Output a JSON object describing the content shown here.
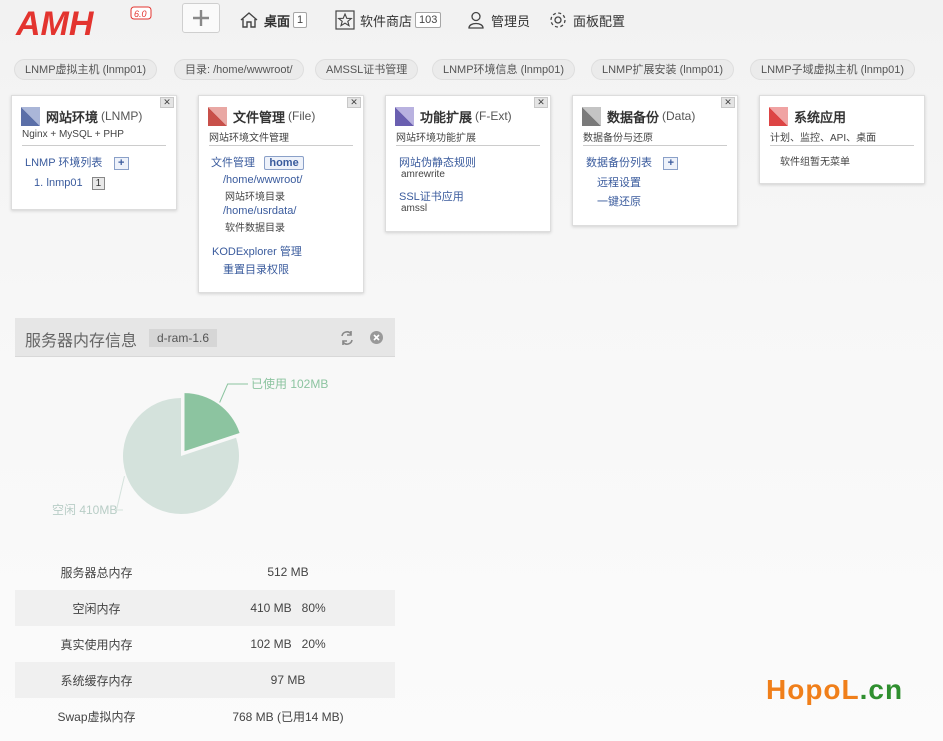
{
  "logo": {
    "text": "AMH",
    "version": "6.0"
  },
  "nav": {
    "desktop": {
      "label": "桌面",
      "count": "1"
    },
    "store": {
      "label": "软件商店",
      "count": "103"
    },
    "admin": {
      "label": "管理员"
    },
    "settings": {
      "label": "面板配置"
    }
  },
  "pills": [
    "LNMP虚拟主机 (lnmp01)",
    "目录: /home/wwwroot/",
    "AMSSL证书管理",
    "LNMP环境信息 (lnmp01)",
    "LNMP扩展安装 (lnmp01)",
    "LNMP子域虚拟主机 (lnmp01)"
  ],
  "cards": {
    "lnmp": {
      "title": "网站环境",
      "en": "(LNMP)",
      "sub": "Nginx + MySQL + PHP",
      "list_label": "LNMP 环境列表",
      "item_index": "1.",
      "item_name": "lnmp01",
      "item_count": "1",
      "color": "#5b6fa8"
    },
    "file": {
      "title": "文件管理",
      "en": "(File)",
      "sub": "网站环境文件管理",
      "link1": "文件管理",
      "home": "home",
      "path1": "/home/wwwroot/",
      "path1_desc": "网站环境目录",
      "path2": "/home/usrdata/",
      "path2_desc": "软件数据目录",
      "kod": "KODExplorer 管理",
      "reset": "重置目录权限",
      "color": "#c8504a"
    },
    "ext": {
      "title": "功能扩展",
      "en": "(F-Ext)",
      "sub": "网站环境功能扩展",
      "l1": "网站伪静态规则",
      "l1_desc": "amrewrite",
      "l2": "SSL证书应用",
      "l2_desc": "amssl",
      "color": "#6a5fb0"
    },
    "backup": {
      "title": "数据备份",
      "en": "(Data)",
      "sub": "数据备份与还原",
      "l1": "数据备份列表",
      "l2": "远程设置",
      "l3": "一键还原",
      "color": "#7a7a7a"
    },
    "apps": {
      "title": "系统应用",
      "sub": "计划、监控、API、桌面",
      "empty": "软件组暂无菜单",
      "color": "#d44"
    }
  },
  "memory": {
    "title": "服务器内存信息",
    "tag": "d-ram-1.6",
    "pie": {
      "used_label": "已使用 102MB",
      "free_label": "空闲 410MB",
      "used_value": 102,
      "free_value": 410,
      "used_color": "#8cc4a0",
      "free_color": "#d4e2dc"
    },
    "rows": [
      {
        "label": "服务器总内存",
        "value": "512 MB"
      },
      {
        "label": "空闲内存",
        "value": "410 MB   80%"
      },
      {
        "label": "真实使用内存",
        "value": "102 MB   20%"
      },
      {
        "label": "系统缓存内存",
        "value": "97 MB"
      },
      {
        "label": "Swap虚拟内存",
        "value": "768 MB (已用14 MB)"
      }
    ]
  },
  "watermark": {
    "brand": "HopoL",
    "domain": ".cn"
  }
}
